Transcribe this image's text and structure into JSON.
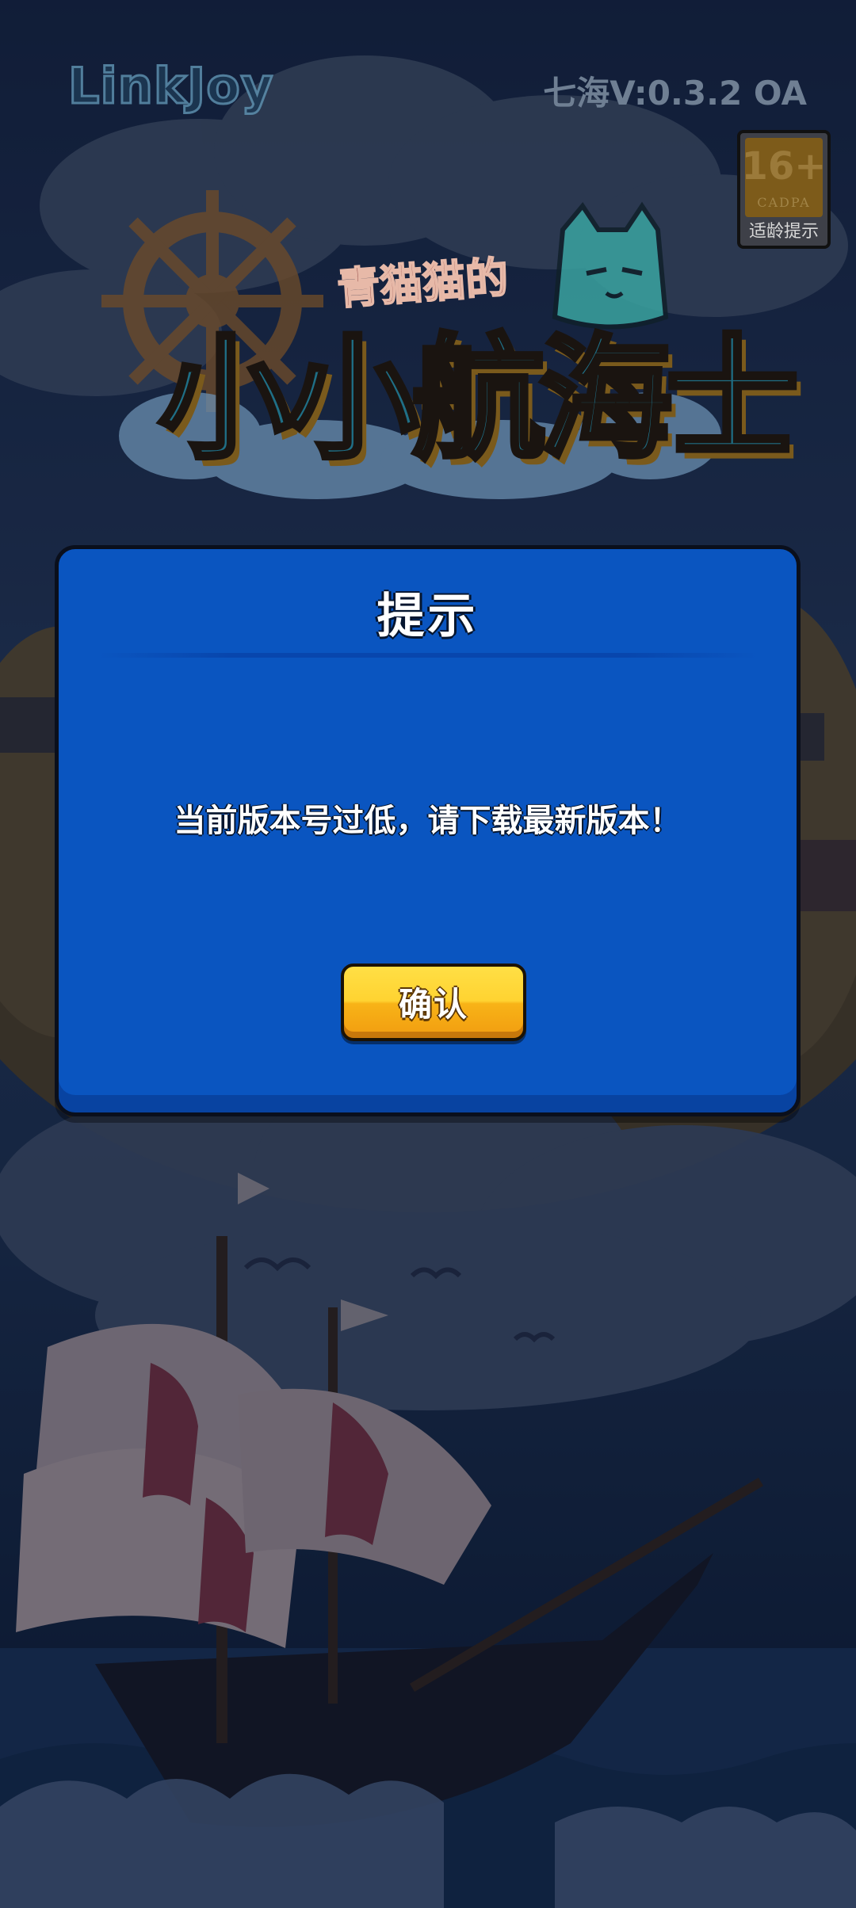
{
  "header": {
    "publisher_logo": "LinkJoy",
    "version": "七海V:0.3.2  OA",
    "age_rating": {
      "number": "16+",
      "org": "CADPA",
      "caption": "适龄提示"
    }
  },
  "game_logo": {
    "subtitle": "青猫猫的",
    "title": "小小航海士"
  },
  "dialog": {
    "title": "提示",
    "message": "当前版本号过低，请下载最新版本！",
    "confirm_label": "确认"
  },
  "colors": {
    "dialog_bg": "#0a55c0",
    "button_yellow": "#ffd331",
    "text_white": "#ffffff"
  }
}
